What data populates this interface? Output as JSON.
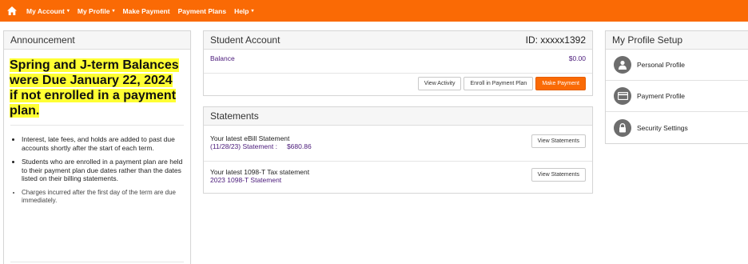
{
  "nav": {
    "items": [
      {
        "label": "My Account",
        "caret": "▾"
      },
      {
        "label": "My Profile",
        "caret": "▾"
      },
      {
        "label": "Make Payment",
        "caret": ""
      },
      {
        "label": "Payment Plans",
        "caret": ""
      },
      {
        "label": "Help",
        "caret": "▾"
      }
    ]
  },
  "announcement": {
    "heading": "Announcement",
    "title": "Spring and J-term Balances were Due January 22, 2024 if not enrolled in a payment plan.",
    "bullets": [
      "Interest, late fees, and holds are added to past due accounts shortly after the start of each term.",
      "Students who are enrolled in a payment plan are held to their payment plan due dates rather than the dates listed on their billing statements.",
      "Charges incurred after the first day of the term are due immediately."
    ]
  },
  "account": {
    "heading": "Student Account",
    "id_label": "ID: xxxxx1392",
    "balance_label": "Balance",
    "balance_value": "$0.00",
    "buttons": {
      "view_activity": "View Activity",
      "enroll": "Enroll in Payment Plan",
      "make_payment": "Make Payment"
    }
  },
  "statements": {
    "heading": "Statements",
    "ebill_title": "Your latest eBill Statement",
    "ebill_detail": "(11/28/23) Statement :",
    "ebill_amount": "$680.86",
    "tax_title": "Your latest 1098-T Tax statement",
    "tax_detail": "2023 1098-T Statement",
    "view_label": "View Statements"
  },
  "profile": {
    "heading": "My Profile Setup",
    "items": [
      {
        "label": "Personal Profile",
        "icon": "person-icon"
      },
      {
        "label": "Payment Profile",
        "icon": "card-icon"
      },
      {
        "label": "Security Settings",
        "icon": "lock-icon"
      }
    ]
  },
  "colors": {
    "accent": "#fa6a05",
    "highlight": "#ffff33",
    "link": "#4a1a7a"
  }
}
